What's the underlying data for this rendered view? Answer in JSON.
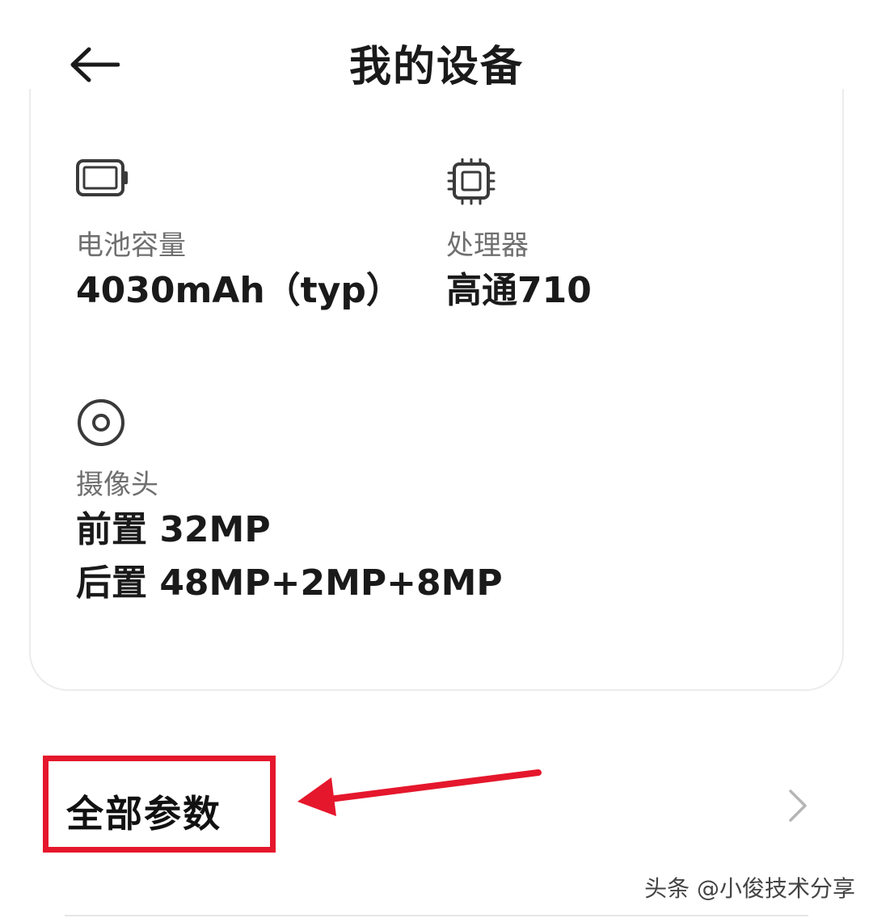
{
  "header": {
    "title": "我的设备",
    "back_icon": "back-arrow-icon"
  },
  "specs": [
    {
      "icon": "battery-icon",
      "label": "电池容量",
      "value": "4030mAh（typ）"
    },
    {
      "icon": "processor-chip-icon",
      "label": "处理器",
      "value": "高通710"
    },
    {
      "icon": "camera-lens-icon",
      "label": "摄像头",
      "values": [
        "前置 32MP",
        "后置 48MP+2MP+8MP"
      ]
    }
  ],
  "params": {
    "label": "全部参数",
    "chevron_icon": "chevron-right-icon"
  },
  "annotation": {
    "color": "#e5172c"
  },
  "watermark": "头条 @小俊技术分享"
}
